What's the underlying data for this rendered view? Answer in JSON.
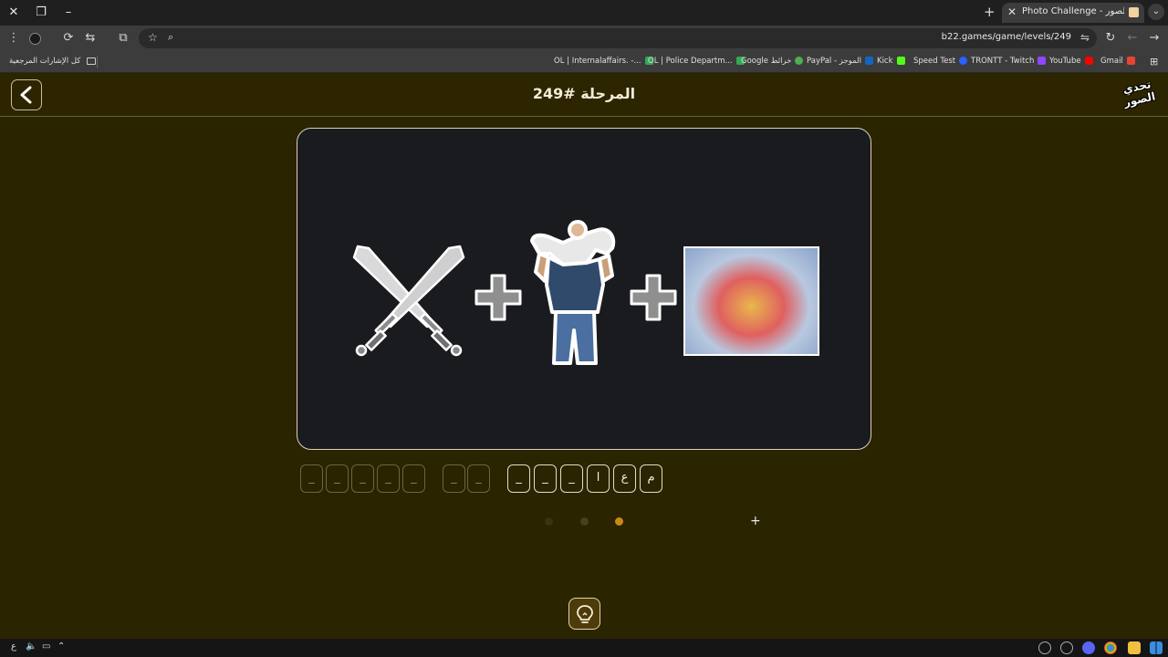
{
  "browser": {
    "tab_title": "Photo Challenge - تحدي الصور",
    "url": "b22.games/game/levels/249",
    "icons": [
      "close-icon",
      "restore-icon",
      "minimize-icon",
      "new-tab-icon",
      "tab-menu-icon",
      "menu-icon",
      "extension-icon",
      "screenshot-icon",
      "translate-icon",
      "bookmark-star-icon",
      "zoom-icon",
      "tune-icon",
      "reload-icon",
      "back-icon",
      "forward-icon"
    ]
  },
  "bookmarks": {
    "folder": "كل الإشارات المرجعية",
    "items": [
      {
        "label": "OL | Internalaffairs. -...",
        "color": "#34a853"
      },
      {
        "label": "OL | Police Departm...",
        "color": "#34a853"
      },
      {
        "label": "Google خرائط",
        "color": "#4caf50"
      },
      {
        "label": "PayPal - الموجز",
        "color": "#1565c0"
      },
      {
        "label": "Kick",
        "color": "#53fc18"
      },
      {
        "label": "Speed Test",
        "color": "#2962ff"
      },
      {
        "label": "TRONTT - Twitch",
        "color": "#9146ff"
      },
      {
        "label": "YouTube",
        "color": "#ff0000"
      },
      {
        "label": "Gmail",
        "color": "#ea4335"
      }
    ]
  },
  "game": {
    "level_title": "المرحلة #249",
    "logo_text": "تحدي الصور",
    "puzzle_images": [
      "crossed-swords-icon",
      "plus-icon",
      "father-carrying-child-image",
      "plus-icon",
      "intestines-image"
    ],
    "answer": {
      "word1": [
        "م",
        "ع",
        "ا",
        "_",
        "_",
        "_"
      ],
      "word2": [
        "_",
        "_"
      ],
      "word3": [
        "_",
        "_",
        "_",
        "_",
        "_"
      ]
    },
    "pagination": {
      "count": 3,
      "active": 2
    },
    "colors": {
      "background": "#2b2400",
      "card": "#1a1b1f",
      "active_dot": "#c98a13",
      "accent": "#e4d7a8"
    }
  },
  "taskbar": {
    "lang": "ع",
    "icons": [
      "volume-icon",
      "network-icon",
      "chevron-up-icon",
      "clock-icon",
      "screen-icon",
      "discord-icon",
      "chrome-icon",
      "folder-icon",
      "windows-icon"
    ]
  }
}
